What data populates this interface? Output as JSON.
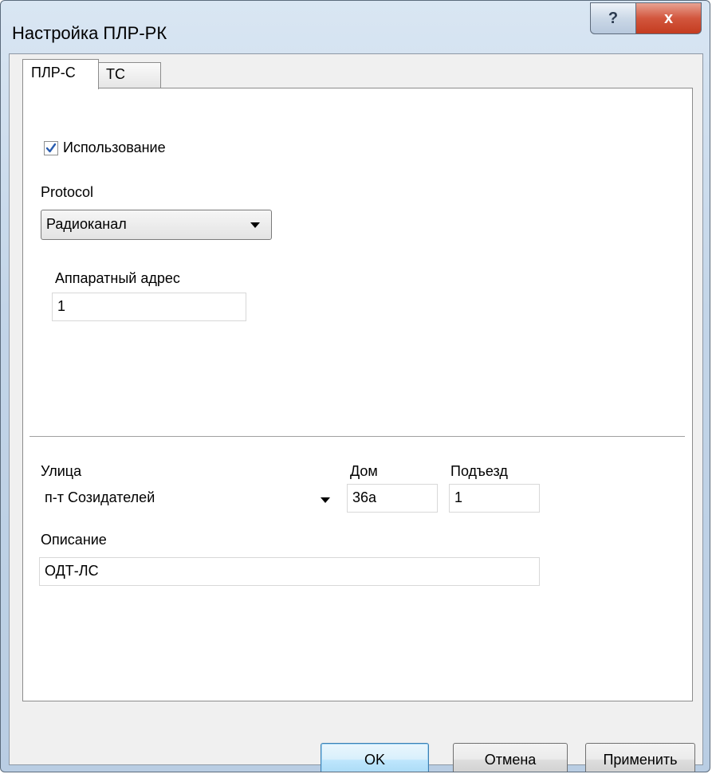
{
  "window": {
    "title": "Настройка ПЛР-РК",
    "help_label": "?",
    "close_label": "x"
  },
  "tabs": [
    {
      "label": "ПЛР-С",
      "active": true
    },
    {
      "label": "ТС",
      "active": false
    }
  ],
  "usage": {
    "label": "Использование",
    "checked": true
  },
  "protocol": {
    "label": "Protocol",
    "value": "Радиоканал"
  },
  "hardware_address": {
    "label": "Аппаратный адрес",
    "value": "1"
  },
  "street": {
    "label": "Улица",
    "value": "п-т Созидателей"
  },
  "house": {
    "label": "Дом",
    "value": "36а"
  },
  "entrance": {
    "label": "Подъезд",
    "value": "1"
  },
  "description": {
    "label": "Описание",
    "value": "ОДТ-ЛС"
  },
  "buttons": {
    "ok": "OK",
    "cancel": "Отмена",
    "apply": "Применить"
  }
}
